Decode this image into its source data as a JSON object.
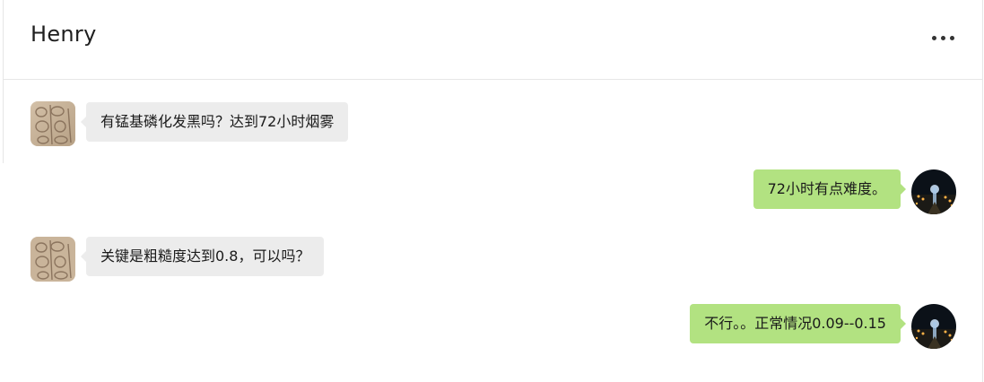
{
  "chat": {
    "contact_name": "Henry",
    "more_icon": "ellipsis-icon"
  },
  "messages": [
    {
      "direction": "in",
      "text": "有锰基磷化发黑吗？达到72小时烟雾",
      "avatar": "stone-carving-avatar"
    },
    {
      "direction": "out",
      "text": "72小时有点难度。",
      "avatar": "night-city-avatar"
    },
    {
      "direction": "in",
      "text": "关键是粗糙度达到0.8，可以吗？",
      "avatar": "stone-carving-avatar"
    },
    {
      "direction": "out",
      "text": "不行。。正常情况0.09--0.15",
      "avatar": "night-city-avatar"
    }
  ],
  "colors": {
    "incoming_bubble": "#ececec",
    "outgoing_bubble": "#b2e281"
  }
}
